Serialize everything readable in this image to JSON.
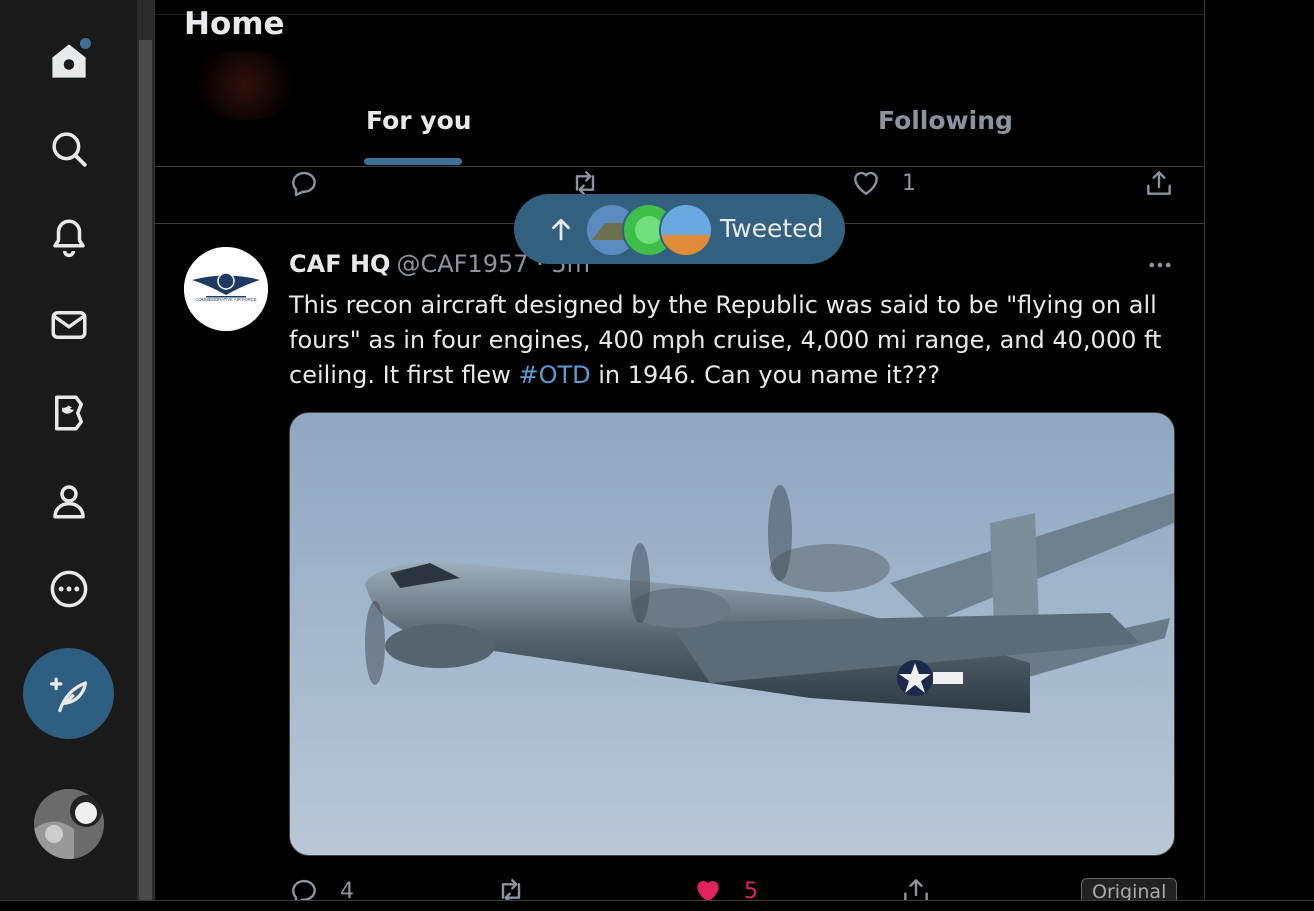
{
  "header": {
    "title": "Home"
  },
  "tabs": [
    {
      "label": "For you",
      "active": true
    },
    {
      "label": "Following",
      "active": false
    }
  ],
  "previous_tweet": {
    "like_count": "1"
  },
  "new_tweets_pill": {
    "label": "Tweeted"
  },
  "tweet": {
    "author_name": "CAF HQ",
    "handle_time": "@CAF1957 · 5m",
    "text_before": "This recon aircraft designed by the Republic was said to be \"flying on all fours\" as in four engines, 400 mph cruise, 4,000 mi range, and 40,000 ft ceiling. It first flew ",
    "hashtag": "#OTD",
    "text_after": " in 1946. Can you name it???",
    "reply_count": "4",
    "like_count": "5",
    "media_badge": "Original",
    "avatar_text": "COMMEMORATIVE AIR FORCE"
  },
  "sidebar": {
    "items": [
      "home-icon",
      "search-icon",
      "bell-icon",
      "mail-icon",
      "twitter-blue-icon",
      "profile-icon",
      "more-circle-icon"
    ],
    "compose": "compose-feather-icon"
  },
  "colors": {
    "accent": "#3f6f96",
    "background": "#000000",
    "sidebar": "#1a1a1a",
    "like": "#e0245e",
    "hashtag": "#5b9bd5"
  }
}
